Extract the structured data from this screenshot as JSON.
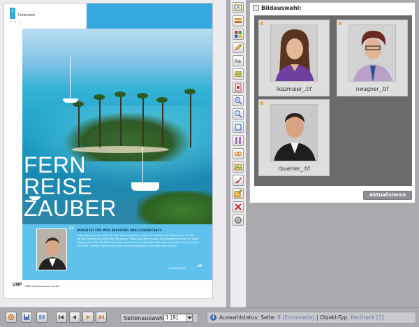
{
  "preview": {
    "section_tab": "8",
    "section_title": "Fernreisen",
    "headline": [
      "FERN",
      "REISE",
      "ZAUBER"
    ],
    "article_lead": "REISEN IST FÜR MICH BERUFUNG UND LEIDENSCHAFT.",
    "article_text": "Unterwegs habe ich mehr als 140 Länder gesehen – mein Herz schlägt seit vielen Jahren für die Karibik. Diese Reise ist für alle, die Sonne, Strand und Meer lieben. Als Reiseleiter möchte ich Ihnen zeigen, wie schön die Welt sein kann, und Ihnen unvergessliche Momente schenken. Sonne, Strand und Meer – steigen Sie ein und lassen Sie sich verzaubern. Ich freue mich auf Sie!",
    "signature": "Robert Bühler",
    "publisher_logo": "UMP",
    "publisher_name": "UMP Individualreisen GmbH"
  },
  "toolbar": {
    "tools": [
      "frame-icon",
      "layers-icon",
      "colors-icon",
      "pencil-icon",
      "text-style-icon",
      "align-icon",
      "document-icon",
      "zoom-in-icon",
      "zoom-out-icon",
      "crop-icon",
      "columns-icon",
      "link-icon",
      "image-icon",
      "brush-icon",
      "export-icon",
      "delete-icon",
      "settings-icon"
    ]
  },
  "image_panel": {
    "title": "Bildauswahl:",
    "images": [
      {
        "filename": "lkazmaier_.tif"
      },
      {
        "filename": "nwagner_.tif"
      },
      {
        "filename": "rbuehler_.tif"
      }
    ],
    "refresh_label": "Aktualisieren"
  },
  "bottom_bar": {
    "page_select_label": "Seitenauswahl:",
    "page_select_value": "1 [8]",
    "status_prefix": "Auswahlstatus: Seite:",
    "status_page": "8",
    "status_page_label": "[Einzelseite]",
    "status_type_prefix": "| Objekt-Typ:",
    "status_type": "Rechteck [1]"
  },
  "colors": {
    "accent": "#35a8e0",
    "panel_dark": "#6b6b6b",
    "pane_background": "#a9a9ae"
  }
}
